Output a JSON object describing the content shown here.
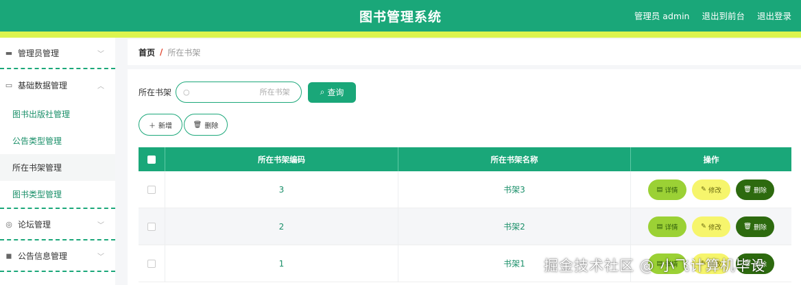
{
  "header": {
    "title": "图书管理系统",
    "admin_label": "管理员 admin",
    "front_link": "退出到前台",
    "logout_link": "退出登录"
  },
  "sidebar": {
    "groups": [
      {
        "label": "管理员管理",
        "icon": "user-card-icon"
      },
      {
        "label": "基础数据管理",
        "icon": "data-box-icon",
        "expanded": true,
        "items": [
          {
            "label": "图书出版社管理"
          },
          {
            "label": "公告类型管理"
          },
          {
            "label": "所在书架管理",
            "active": true
          },
          {
            "label": "图书类型管理"
          }
        ]
      },
      {
        "label": "论坛管理",
        "icon": "compass-icon"
      },
      {
        "label": "公告信息管理",
        "icon": "wallet-icon"
      }
    ]
  },
  "breadcrumb": {
    "home": "首页",
    "separator": "/",
    "current": "所在书架"
  },
  "search": {
    "label": "所在书架",
    "placeholder": "所在书架",
    "button": "查询"
  },
  "actions": {
    "add": "新增",
    "delete": "删除"
  },
  "table": {
    "headers": [
      "所在书架编码",
      "所在书架名称",
      "操作"
    ],
    "rows": [
      {
        "code": "3",
        "name": "书架3"
      },
      {
        "code": "2",
        "name": "书架2"
      },
      {
        "code": "1",
        "name": "书架1"
      }
    ],
    "row_actions": {
      "detail": "详情",
      "edit": "修改",
      "delete": "删除"
    }
  },
  "colors": {
    "primary": "#1aa779",
    "accent_stripe": "#dcf44e",
    "detail": "#9bd135",
    "edit": "#f6f56c",
    "delete": "#2d6a0f"
  },
  "watermark": "掘金技术社区 @ 小飞计算机毕设"
}
